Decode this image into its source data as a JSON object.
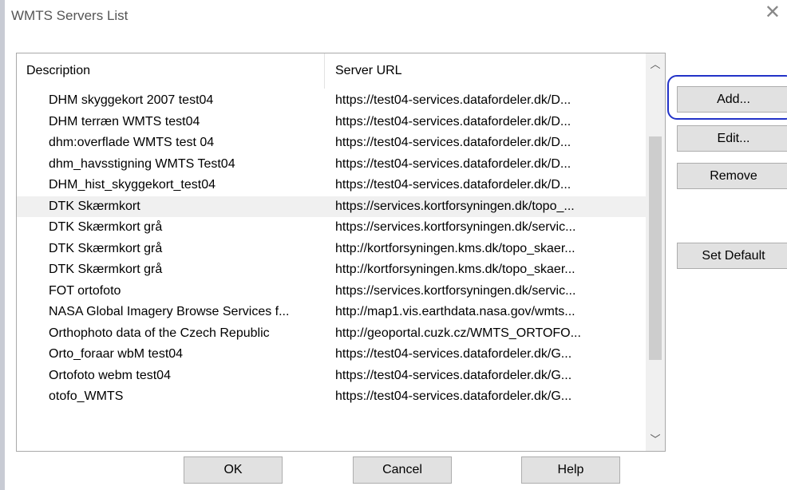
{
  "window": {
    "title": "WMTS Servers List"
  },
  "icons": {
    "close": "close-icon",
    "scroll_up": "chevron-up-icon",
    "scroll_down": "chevron-down-icon"
  },
  "table": {
    "columns": {
      "description": "Description",
      "url": "Server URL"
    },
    "rows": [
      {
        "description": "DHM skyggekort 2007 test04",
        "url": "https://test04-services.datafordeler.dk/D..."
      },
      {
        "description": "DHM terræn WMTS test04",
        "url": "https://test04-services.datafordeler.dk/D..."
      },
      {
        "description": "dhm:overflade WMTS test 04",
        "url": "https://test04-services.datafordeler.dk/D..."
      },
      {
        "description": "dhm_havsstigning WMTS Test04",
        "url": "https://test04-services.datafordeler.dk/D..."
      },
      {
        "description": "DHM_hist_skyggekort_test04",
        "url": "https://test04-services.datafordeler.dk/D..."
      },
      {
        "description": "DTK Skærmkort",
        "url": "https://services.kortforsyningen.dk/topo_..."
      },
      {
        "description": "DTK Skærmkort grå",
        "url": "https://services.kortforsyningen.dk/servic..."
      },
      {
        "description": "DTK Skærmkort grå",
        "url": "http://kortforsyningen.kms.dk/topo_skaer..."
      },
      {
        "description": "DTK Skærmkort grå",
        "url": "http://kortforsyningen.kms.dk/topo_skaer..."
      },
      {
        "description": "FOT ortofoto",
        "url": "https://services.kortforsyningen.dk/servic..."
      },
      {
        "description": "NASA Global Imagery Browse Services f...",
        "url": "http://map1.vis.earthdata.nasa.gov/wmts..."
      },
      {
        "description": "Orthophoto data of the Czech Republic",
        "url": "http://geoportal.cuzk.cz/WMTS_ORTOFO..."
      },
      {
        "description": "Orto_foraar wbM test04",
        "url": "https://test04-services.datafordeler.dk/G..."
      },
      {
        "description": "Ortofoto webm test04",
        "url": "https://test04-services.datafordeler.dk/G..."
      },
      {
        "description": "otofo_WMTS",
        "url": "https://test04-services.datafordeler.dk/G..."
      }
    ],
    "selected_index": 5
  },
  "side_buttons": {
    "add": "Add...",
    "edit": "Edit...",
    "remove": "Remove",
    "set_default": "Set Default"
  },
  "bottom_buttons": {
    "ok": "OK",
    "cancel": "Cancel",
    "help": "Help"
  },
  "colors": {
    "highlight": "#2232c8",
    "selected_row": "#f0f0f0",
    "button_face": "#e1e1e1"
  }
}
